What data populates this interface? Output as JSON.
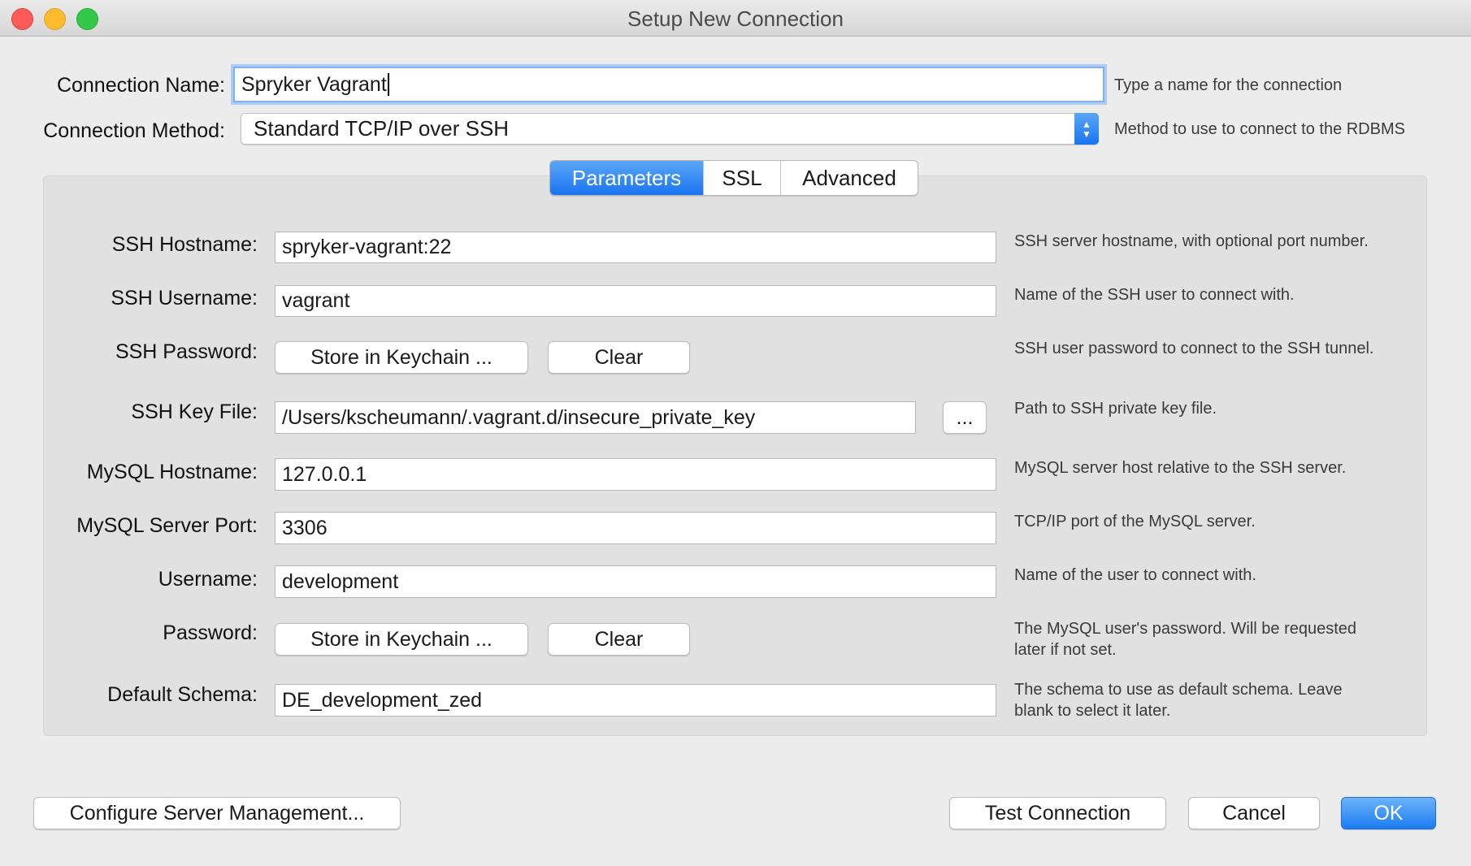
{
  "window": {
    "title": "Setup New Connection"
  },
  "connection_name": {
    "label": "Connection Name:",
    "value": "Spryker Vagrant",
    "hint": "Type a name for the connection"
  },
  "connection_method": {
    "label": "Connection Method:",
    "value": "Standard TCP/IP over SSH",
    "hint": "Method to use to connect to the RDBMS"
  },
  "tabs": [
    {
      "label": "Parameters",
      "active": true
    },
    {
      "label": "SSL",
      "active": false
    },
    {
      "label": "Advanced",
      "active": false
    }
  ],
  "params": {
    "ssh_hostname": {
      "label": "SSH Hostname:",
      "value": "spryker-vagrant:22",
      "hint": "SSH server hostname, with  optional port number."
    },
    "ssh_username": {
      "label": "SSH Username:",
      "value": "vagrant",
      "hint": "Name of the SSH user to connect with."
    },
    "ssh_password": {
      "label": "SSH Password:",
      "store_label": "Store in Keychain ...",
      "clear_label": "Clear",
      "hint": "SSH user password to connect to the SSH tunnel."
    },
    "ssh_key_file": {
      "label": "SSH Key File:",
      "value": "/Users/kscheumann/.vagrant.d/insecure_private_key",
      "browse_label": "...",
      "hint": "Path to SSH private key file."
    },
    "mysql_hostname": {
      "label": "MySQL Hostname:",
      "value": "127.0.0.1",
      "hint": "MySQL server host relative to the SSH server."
    },
    "mysql_port": {
      "label": "MySQL Server Port:",
      "value": "3306",
      "hint": "TCP/IP port of the MySQL server."
    },
    "username": {
      "label": "Username:",
      "value": "development",
      "hint": "Name of the user to connect with."
    },
    "password": {
      "label": "Password:",
      "store_label": "Store in Keychain ...",
      "clear_label": "Clear",
      "hint_line1": "The MySQL user's password. Will be requested",
      "hint_line2": "later if not set."
    },
    "default_schema": {
      "label": "Default Schema:",
      "value": "DE_development_zed",
      "hint_line1": "The schema to use as default schema. Leave",
      "hint_line2": "blank to select it later."
    }
  },
  "footer": {
    "configure_label": "Configure Server Management...",
    "test_label": "Test Connection",
    "cancel_label": "Cancel",
    "ok_label": "OK"
  }
}
